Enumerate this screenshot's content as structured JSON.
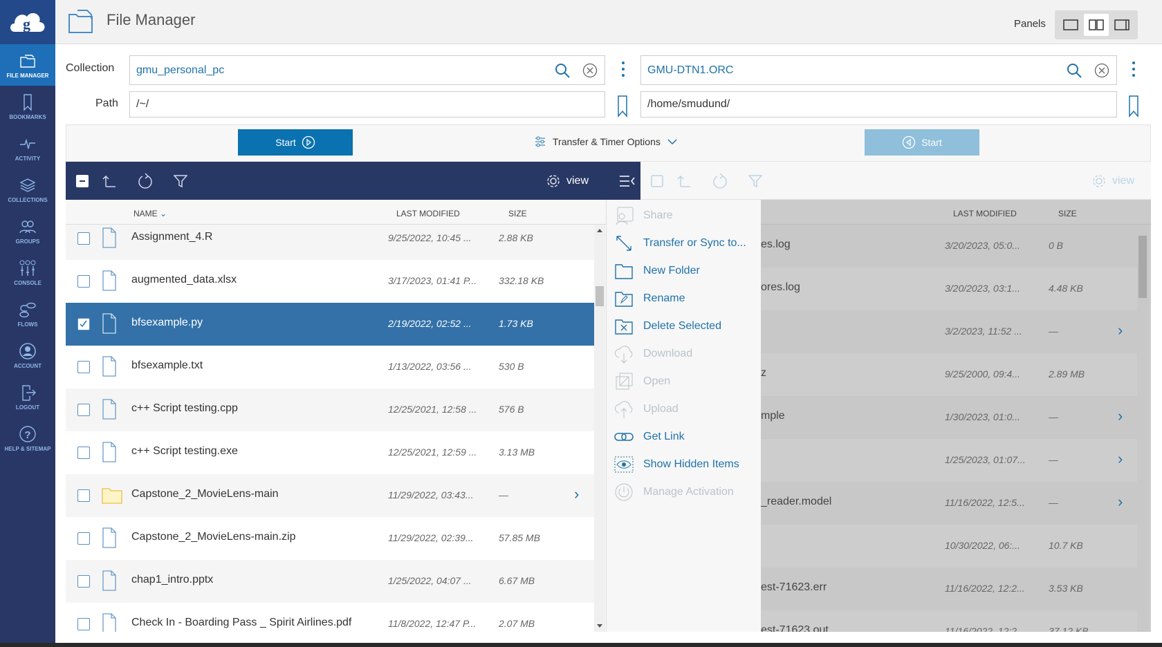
{
  "app": {
    "title": "File Manager",
    "panels_label": "Panels"
  },
  "colors": {
    "sidebar": "#283766",
    "sidebar_active": "#1e6fb8",
    "toolbar": "#283865",
    "selected_row": "#3371a8",
    "accent": "#1f72aa",
    "start_disabled": "#8fbfdb"
  },
  "sidebar": {
    "items": [
      {
        "label": "FILE MANAGER",
        "icon": "folder-icon",
        "active": true
      },
      {
        "label": "BOOKMARKS",
        "icon": "bookmark-icon"
      },
      {
        "label": "ACTIVITY",
        "icon": "activity-icon"
      },
      {
        "label": "COLLECTIONS",
        "icon": "layers-icon"
      },
      {
        "label": "GROUPS",
        "icon": "users-icon"
      },
      {
        "label": "CONSOLE",
        "icon": "sliders-icon"
      },
      {
        "label": "FLOWS",
        "icon": "flows-icon"
      },
      {
        "label": "ACCOUNT",
        "icon": "account-icon"
      },
      {
        "label": "LOGOUT",
        "icon": "logout-icon"
      },
      {
        "label": "HELP & SITEMAP",
        "icon": "help-icon"
      }
    ]
  },
  "form": {
    "collection_label": "Collection",
    "path_label": "Path",
    "left": {
      "collection": "gmu_personal_pc",
      "path": "/~/"
    },
    "right": {
      "collection": "GMU-DTN1.ORC",
      "path": "/home/smudund/"
    }
  },
  "transfer": {
    "start_label": "Start",
    "options_label": "Transfer & Timer Options"
  },
  "toolbar": {
    "view_label": "view"
  },
  "columns": {
    "name": "NAME",
    "modified": "LAST MODIFIED",
    "size": "SIZE"
  },
  "left_files": [
    {
      "name": "Assignment_4.R",
      "modified": "9/25/2022, 10:45 ...",
      "size": "2.88 KB",
      "type": "file"
    },
    {
      "name": "augmented_data.xlsx",
      "modified": "3/17/2023, 01:41 P...",
      "size": "332.18 KB",
      "type": "file"
    },
    {
      "name": "bfsexample.py",
      "modified": "2/19/2022, 02:52 ...",
      "size": "1.73 KB",
      "type": "file",
      "selected": true
    },
    {
      "name": "bfsexample.txt",
      "modified": "1/13/2022, 03:56 ...",
      "size": "530 B",
      "type": "file"
    },
    {
      "name": "c++ Script testing.cpp",
      "modified": "12/25/2021, 12:58 ...",
      "size": "576 B",
      "type": "file"
    },
    {
      "name": "c++ Script testing.exe",
      "modified": "12/25/2021, 12:59 ...",
      "size": "3.13 MB",
      "type": "file"
    },
    {
      "name": "Capstone_2_MovieLens-main",
      "modified": "11/29/2022, 03:43...",
      "size": "—",
      "type": "folder"
    },
    {
      "name": "Capstone_2_MovieLens-main.zip",
      "modified": "11/29/2022, 02:39...",
      "size": "57.85 MB",
      "type": "file"
    },
    {
      "name": "chap1_intro.pptx",
      "modified": "1/25/2022, 04:07 ...",
      "size": "6.67 MB",
      "type": "file"
    },
    {
      "name": "Check In - Boarding Pass _ Spirit Airlines.pdf",
      "modified": "11/8/2022, 12:47 P...",
      "size": "2.07 MB",
      "type": "file"
    }
  ],
  "right_files": [
    {
      "name": "es.log",
      "modified": "3/20/2023, 05:0...",
      "size": "0 B"
    },
    {
      "name": "ores.log",
      "modified": "3/20/2023, 03:1...",
      "size": "4.48 KB"
    },
    {
      "name": "",
      "modified": "3/2/2023, 11:52 ...",
      "size": "—",
      "folder": true
    },
    {
      "name": "z",
      "modified": "9/25/2000, 09:4...",
      "size": "2.89 MB"
    },
    {
      "name": "mple",
      "modified": "1/30/2023, 01:0...",
      "size": "—",
      "folder": true
    },
    {
      "name": "",
      "modified": "1/25/2023, 01:07...",
      "size": "—",
      "folder": true
    },
    {
      "name": "_reader.model",
      "modified": "11/16/2022, 12:5...",
      "size": "—",
      "folder": true
    },
    {
      "name": "",
      "modified": "10/30/2022, 06:...",
      "size": "10.7 KB"
    },
    {
      "name": "est-71623.err",
      "modified": "11/16/2022, 12:2...",
      "size": "3.53 KB"
    },
    {
      "name": "est-71623.out",
      "modified": "11/16/2022, 12:2...",
      "size": "37.12 KB"
    }
  ],
  "menu": [
    {
      "label": "Share",
      "enabled": false,
      "icon": "share-icon"
    },
    {
      "label": "Transfer or Sync to...",
      "enabled": true,
      "icon": "transfer-icon"
    },
    {
      "label": "New Folder",
      "enabled": true,
      "icon": "new-folder-icon"
    },
    {
      "label": "Rename",
      "enabled": true,
      "icon": "rename-icon"
    },
    {
      "label": "Delete Selected",
      "enabled": true,
      "icon": "delete-icon"
    },
    {
      "label": "Download",
      "enabled": false,
      "icon": "download-icon"
    },
    {
      "label": "Open",
      "enabled": false,
      "icon": "open-icon"
    },
    {
      "label": "Upload",
      "enabled": false,
      "icon": "upload-icon"
    },
    {
      "label": "Get Link",
      "enabled": true,
      "icon": "link-icon"
    },
    {
      "label": "Show Hidden Items",
      "enabled": true,
      "icon": "eye-icon"
    },
    {
      "label": "Manage Activation",
      "enabled": false,
      "icon": "power-icon"
    }
  ]
}
